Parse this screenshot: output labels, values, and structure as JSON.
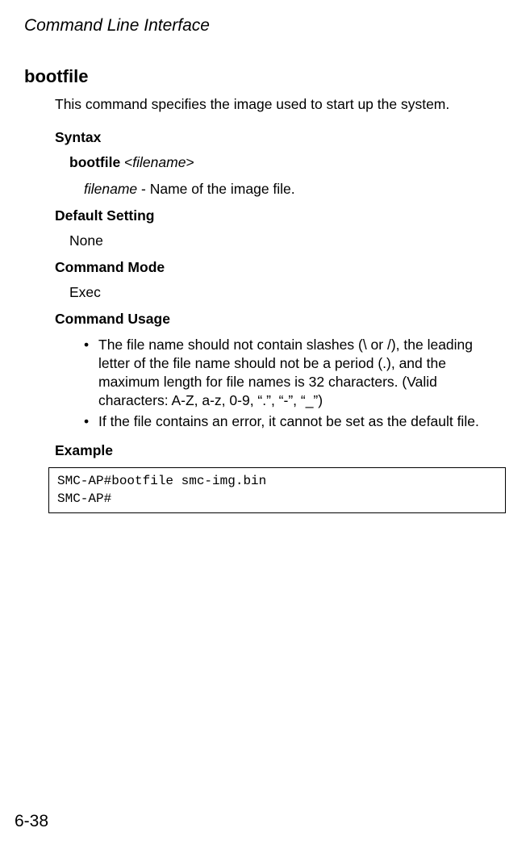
{
  "header": "Command Line Interface",
  "command_name": "bootfile",
  "description": "This command specifies the image used to start up the system.",
  "syntax": {
    "heading": "Syntax",
    "command": "bootfile",
    "param": "filename",
    "open_bracket": "<",
    "close_bracket": ">",
    "explain_param": "filename",
    "explain_text": " - Name of the image file."
  },
  "default_setting": {
    "heading": "Default Setting",
    "value": "None"
  },
  "command_mode": {
    "heading": "Command Mode",
    "value": "Exec"
  },
  "command_usage": {
    "heading": "Command Usage",
    "bullets": [
      "The file name should not contain slashes (\\ or /), the leading letter of the file name should not be a period (.), and the maximum length for file names is 32 characters. (Valid characters: A-Z, a-z, 0-9, “.”, “-”, “_”)",
      "If the file contains an error, it cannot be set as the default file."
    ]
  },
  "example": {
    "heading": "Example",
    "code": "SMC-AP#bootfile smc-img.bin\nSMC-AP#"
  },
  "page_number": "6-38"
}
